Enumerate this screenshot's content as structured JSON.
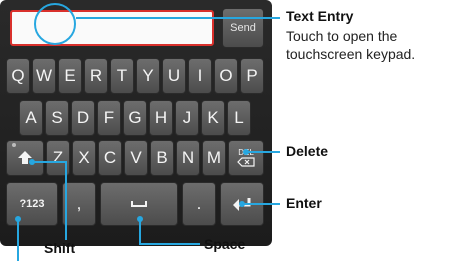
{
  "keyboard": {
    "send_label": "Send",
    "row1": [
      "Q",
      "W",
      "E",
      "R",
      "T",
      "Y",
      "U",
      "I",
      "O",
      "P"
    ],
    "row2": [
      "A",
      "S",
      "D",
      "F",
      "G",
      "H",
      "J",
      "K",
      "L"
    ],
    "row3": [
      "Z",
      "X",
      "C",
      "V",
      "B",
      "N",
      "M"
    ],
    "del_label": "DEL",
    "symbols_label": "?123",
    "comma_label": ",",
    "period_label": "."
  },
  "callouts": {
    "text_entry_title": "Text Entry",
    "text_entry_desc_line1": "Touch to open the",
    "text_entry_desc_line2": "touchscreen keypad.",
    "delete": "Delete",
    "enter": "Enter",
    "shift": "Shift",
    "space": "Space"
  },
  "colors": {
    "callout_blue": "#27a7e0",
    "entry_border": "#d9302c"
  }
}
